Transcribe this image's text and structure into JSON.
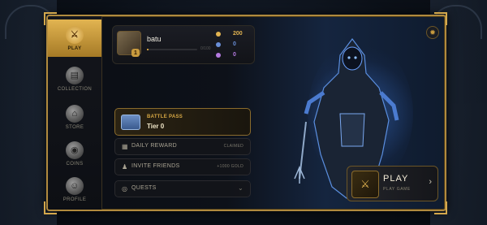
{
  "sidebar": {
    "items": [
      {
        "label": "PLAY",
        "icon": "crossed-swords-icon",
        "active": true
      },
      {
        "label": "COLLECTION",
        "icon": "cards-icon",
        "active": false
      },
      {
        "label": "STORE",
        "icon": "store-icon",
        "active": false
      },
      {
        "label": "COINS",
        "icon": "coins-icon",
        "active": false
      },
      {
        "label": "PROFILE",
        "icon": "profile-icon",
        "active": false
      }
    ]
  },
  "profile": {
    "username": "batu",
    "level": "1",
    "xp_text": "0/100",
    "xp_progress": 0.04,
    "currencies": [
      {
        "name": "gold",
        "value": "200",
        "color": "#e2b451"
      },
      {
        "name": "gems",
        "value": "0",
        "color": "#6a8fd8"
      },
      {
        "name": "shards",
        "value": "0",
        "color": "#b57ae0"
      }
    ]
  },
  "battle_pass": {
    "label": "BATTLE PASS",
    "tier": "Tier 0"
  },
  "rows": {
    "daily_reward": {
      "label": "DAILY REWARD",
      "status": "CLAIMED"
    },
    "invite_friends": {
      "label": "INVITE FRIENDS",
      "reward": "+1000 GOLD"
    },
    "quests": {
      "label": "QUESTS"
    }
  },
  "play_button": {
    "title": "PLAY",
    "subtitle": "PLAY GAME"
  },
  "colors": {
    "accent": "#c89a3e",
    "frame": "#b08a3e",
    "hero_glow": "#468cff"
  }
}
